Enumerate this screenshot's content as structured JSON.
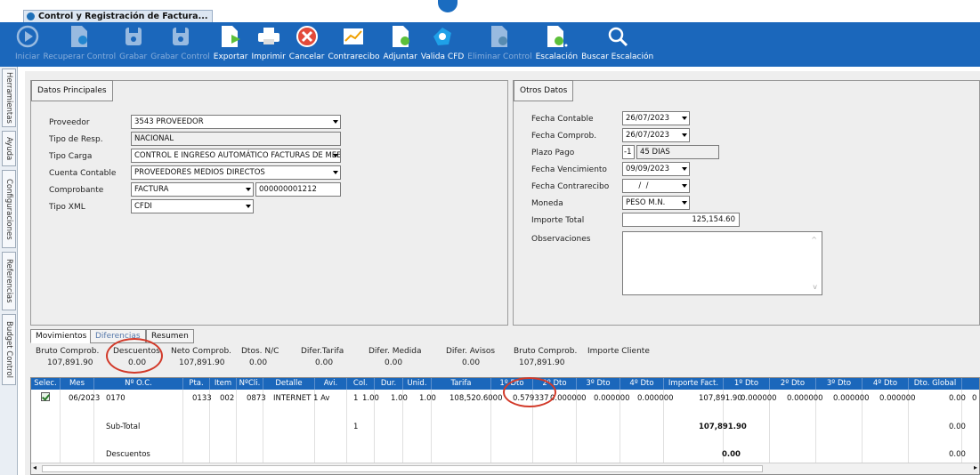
{
  "window": {
    "tab_title": "Control y Registración de Factura..."
  },
  "toolbar": [
    {
      "label": "Iniciar",
      "icon": "play-icon",
      "enabled": false
    },
    {
      "label": "Recuperar Control",
      "icon": "recover-doc-icon",
      "enabled": false
    },
    {
      "label": "Grabar",
      "icon": "save-icon",
      "enabled": false
    },
    {
      "label": "Grabar Control",
      "icon": "save-control-icon",
      "enabled": false
    },
    {
      "label": "Exportar",
      "icon": "export-icon",
      "enabled": true
    },
    {
      "label": "Imprimir",
      "icon": "print-icon",
      "enabled": true
    },
    {
      "label": "Cancelar",
      "icon": "cancel-icon",
      "enabled": true
    },
    {
      "label": "Contrarecibo",
      "icon": "chart-icon",
      "enabled": true
    },
    {
      "label": "Adjuntar",
      "icon": "attach-icon",
      "enabled": true
    },
    {
      "label": "Valida CFD",
      "icon": "validate-icon",
      "enabled": true
    },
    {
      "label": "Eliminar Control",
      "icon": "delete-doc-icon",
      "enabled": false
    },
    {
      "label": "Escalación",
      "icon": "escalation-icon",
      "enabled": true
    },
    {
      "label": "Buscar Escalación",
      "icon": "search-icon",
      "enabled": true
    }
  ],
  "sidetabs": [
    "Herramientas",
    "Ayuda",
    "Configuraciones",
    "Referencias",
    "Budget Control"
  ],
  "datos_principales": {
    "tab": "Datos Principales",
    "proveedor": {
      "label": "Proveedor",
      "value": "3543 PROVEEDOR"
    },
    "tipo_resp": {
      "label": "Tipo de Resp.",
      "value": "NACIONAL"
    },
    "tipo_carga": {
      "label": "Tipo Carga",
      "value": "CONTROL E INGRESO AUTOMÁTICO FACTURAS DE MEE"
    },
    "cuenta_contable": {
      "label": "Cuenta Contable",
      "value": "PROVEEDORES MEDIOS DIRECTOS"
    },
    "comprobante": {
      "label": "Comprobante",
      "value": "FACTURA",
      "numero": "000000001212"
    },
    "tipo_xml": {
      "label": "Tipo XML",
      "value": "CFDI"
    }
  },
  "otros_datos": {
    "tab": "Otros Datos",
    "fecha_contable": {
      "label": "Fecha Contable",
      "value": "26/07/2023"
    },
    "fecha_comprob": {
      "label": "Fecha Comprob.",
      "value": "26/07/2023"
    },
    "plazo_pago": {
      "label": "Plazo Pago",
      "value": "-1",
      "dias": "45 DIAS"
    },
    "fecha_venc": {
      "label": "Fecha Vencimiento",
      "value": "09/09/2023"
    },
    "fecha_contrarecibo": {
      "label": "Fecha Contrarecibo",
      "value": "  /  /"
    },
    "moneda": {
      "label": "Moneda",
      "value": "PESO M.N."
    },
    "importe_total": {
      "label": "Importe Total",
      "value": "125,154.60"
    },
    "observaciones": {
      "label": "Observaciones",
      "value": ""
    }
  },
  "lower_tabs": [
    "Movimientos",
    "Diferencias",
    "Resumen"
  ],
  "summary": [
    {
      "label": "Bruto Comprob.",
      "value": "107,891.90"
    },
    {
      "label": "Descuentos",
      "value": "0.00"
    },
    {
      "label": "Neto Comprob.",
      "value": "107,891.90"
    },
    {
      "label": "Dtos. N/C",
      "value": "0.00"
    },
    {
      "label": "Difer.Tarifa",
      "value": "0.00"
    },
    {
      "label": "Difer. Medida",
      "value": "0.00"
    },
    {
      "label": "Difer. Avisos",
      "value": "0.00"
    },
    {
      "label": "Bruto Comprob.",
      "value": "107,891.90"
    },
    {
      "label": "Importe Cliente",
      "value": ""
    }
  ],
  "grid": {
    "columns": [
      "Selec.",
      "Mes",
      "Nº O.C.",
      "Pta.",
      "Item",
      "NºCli.",
      "Detalle",
      "Avi.",
      "Col.",
      "Dur.",
      "Unid.",
      "Tarifa",
      "1º Dto",
      "2º Dto",
      "3º Dto",
      "4º Dto",
      "Importe Fact.",
      "1º Dto",
      "2º Dto",
      "3º Dto",
      "4º Dto",
      "Dto. Global"
    ],
    "row": {
      "mes": "06/2023",
      "oc": "0170",
      "pta": "0133",
      "item": "002",
      "ncli": "0873",
      "detalle": "INTERNET 1 Av",
      "avi": "1",
      "col": "1.00",
      "dur": "1.00",
      "unid": "1.00",
      "tarifa": "108,520.6000",
      "dto1": "0.579337",
      "dto2": "0.000000",
      "dto3": "0.000000",
      "dto4": "0.000000",
      "importe": "107,891.90",
      "idto1": "0.000000",
      "idto2": "0.000000",
      "idto3": "0.000000",
      "idto4": "0.000000",
      "dto_global": "0.00",
      "extra": "0"
    },
    "subtotal": {
      "label": "Sub-Total",
      "avi": "1",
      "importe": "107,891.90",
      "dto_global": "0.00"
    },
    "descuentos": {
      "label": "Descuentos",
      "importe": "0.00",
      "dto_global": "0.00"
    }
  }
}
